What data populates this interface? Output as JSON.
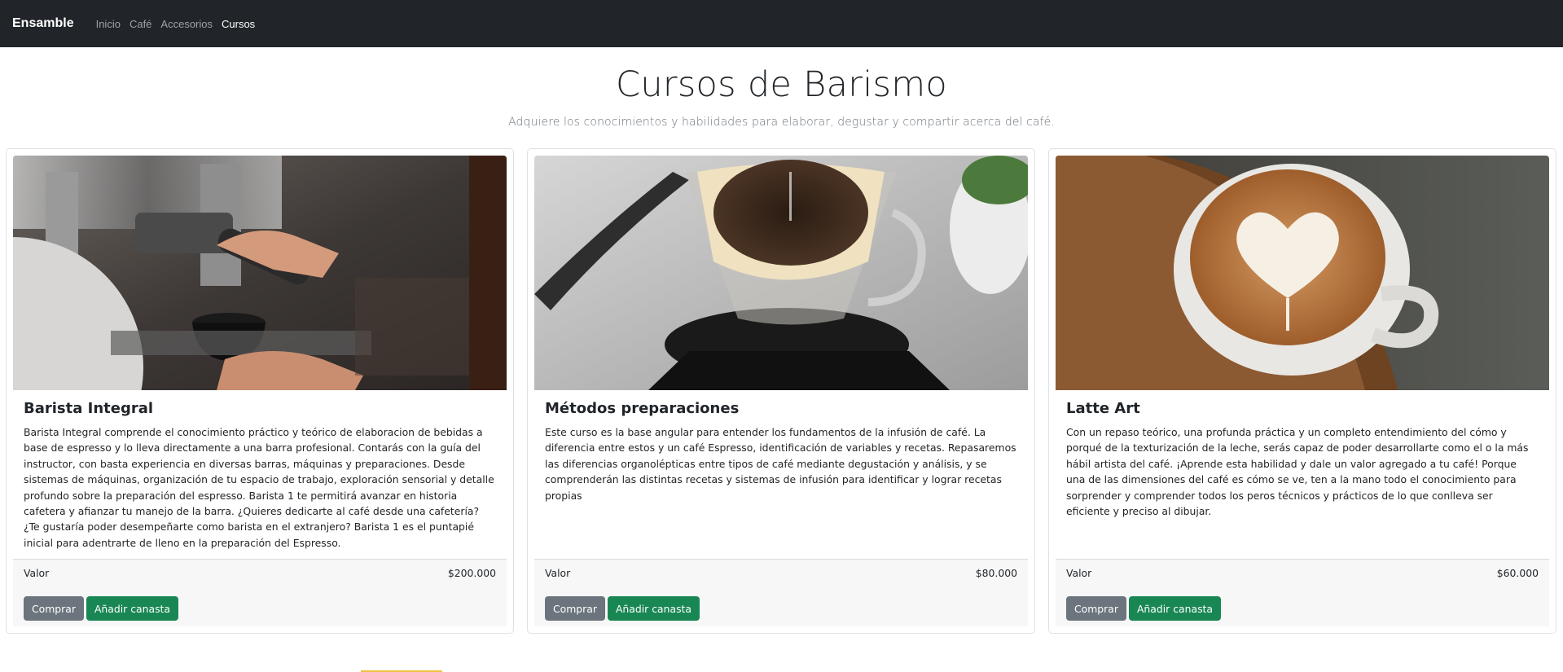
{
  "navbar": {
    "brand": "Ensamble",
    "links": [
      {
        "label": "Inicio",
        "active": false
      },
      {
        "label": "Café",
        "active": false
      },
      {
        "label": "Accesorios",
        "active": false
      },
      {
        "label": "Cursos",
        "active": true
      }
    ]
  },
  "hero": {
    "title": "Cursos de Barismo",
    "subtitle": "Adquiere los conocimientos y habilidades para elaborar, degustar y compartir acerca del café."
  },
  "cards": [
    {
      "title": "Barista Integral",
      "text": "Barista Integral comprende el conocimiento práctico y teórico de elaboracion de bebidas a base de espresso y lo lleva directamente a una barra profesional. Contarás con la guía del instructor, con basta experiencia en diversas barras, máquinas y preparaciones. Desde sistemas de máquinas, organización de tu espacio de trabajo, exploración sensorial y detalle profundo sobre la preparación del espresso. Barista 1 te permitirá avanzar en historia cafetera y afianzar tu manejo de la barra. ¿Quieres dedicarte al café desde una cafetería? ¿Te gustaría poder desempeñarte como barista en el extranjero? Barista 1 es el puntapié inicial para adentrarte de lleno en la preparación del Espresso.",
      "price_label": "Valor",
      "price": "$200.000",
      "buy_label": "Comprar",
      "cart_label": "Añadir canasta"
    },
    {
      "title": "Métodos preparaciones",
      "text": "Este curso es la base angular para entender los fundamentos de la infusión de café. La diferencia entre estos y un café Espresso, identificación de variables y recetas. Repasaremos las diferencias organolépticas entre tipos de café mediante degustación y análisis, y se comprenderán las distintas recetas y sistemas de infusión para identificar y lograr recetas propias",
      "price_label": "Valor",
      "price": "$80.000",
      "buy_label": "Comprar",
      "cart_label": "Añadir canasta"
    },
    {
      "title": "Latte Art",
      "text": "Con un repaso teórico, una profunda práctica y un completo entendimiento del cómo y porqué de la texturización de la leche, serás capaz de poder desarrollarte como el o la más hábil artista del café. ¡Aprende esta habilidad y dale un valor agregado a tu café! Porque una de las dimensiones del café es cómo se ve, ten a la mano todo el conocimiento para sorprender y comprender todos los peros técnicos y prácticos de lo que conlleva ser eficiente y preciso al dibujar.",
      "price_label": "Valor",
      "price": "$60.000",
      "buy_label": "Comprar",
      "cart_label": "Añadir canasta"
    }
  ],
  "colors": {
    "navbar_bg": "#212529",
    "btn_secondary": "#6c757d",
    "btn_success": "#198754"
  }
}
